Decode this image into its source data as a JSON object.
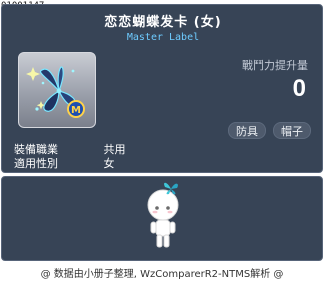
{
  "item": {
    "id": "01001147",
    "name": "恋恋蝴蝶发卡 (女)",
    "label": "Master Label",
    "power_label": "戰鬥力提升量",
    "power_value": "0",
    "tags": [
      "防具",
      "帽子"
    ],
    "job_label": "裝備職業",
    "job_value": "共用",
    "gender_label": "適用性別",
    "gender_value": "女"
  },
  "footer": {
    "text": "@ 数据由小册子整理, WzComparerR2-NTMS解析 @"
  },
  "colors": {
    "panel_bg": "#374456",
    "label_accent": "#6ecbff",
    "butterfly": "#243a6b",
    "glow": "#8ff0ff"
  },
  "icons": {
    "item": "butterfly-hairpin-icon",
    "medal": "master-medal-icon",
    "character": "character-preview"
  }
}
